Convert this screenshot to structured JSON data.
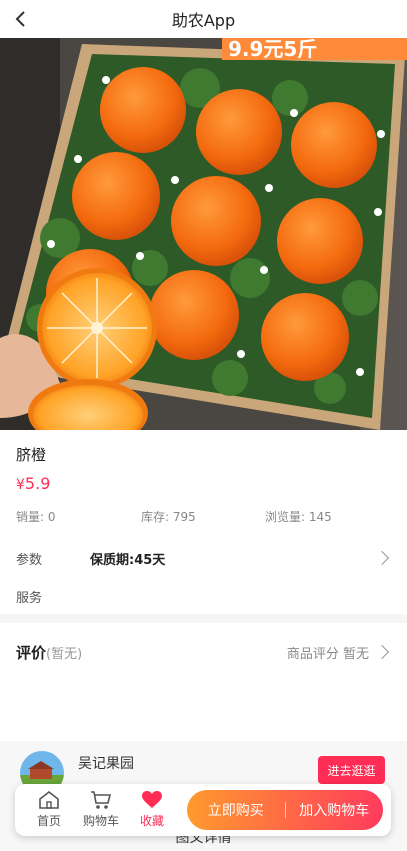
{
  "header": {
    "title": "助农App"
  },
  "hero": {
    "banner_text": "9.9元5斤"
  },
  "product": {
    "name": "脐橙",
    "price_symbol": "¥",
    "price_value": "5.9",
    "sales": "销量: 0",
    "stock": "库存: 795",
    "views": "浏览量: 145",
    "param_label": "参数",
    "param_value": "保质期:45天",
    "service_label": "服务"
  },
  "review": {
    "title": "评价",
    "title_sub": "(暂无)",
    "score": "商品评分 暂无"
  },
  "shop": {
    "name": "吴记果园",
    "visit_label": "进去逛逛"
  },
  "detail_heading": "图文详情",
  "bottom_bar": {
    "home_label": "首页",
    "cart_label": "购物车",
    "fav_label": "收藏",
    "buy_label": "立即购买",
    "add_cart_label": "加入购物车"
  },
  "colors": {
    "accent": "#ff2d55",
    "gradient_start": "#ff9a2e",
    "gradient_end": "#ff3b5c"
  }
}
